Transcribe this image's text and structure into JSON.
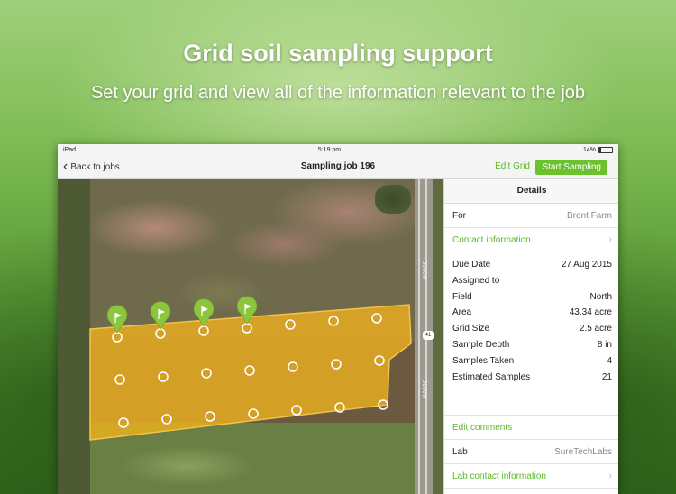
{
  "hero": {
    "title": "Grid soil sampling support",
    "subtitle": "Set your grid and view all of the information relevant to the job"
  },
  "statusbar": {
    "device": "iPad",
    "time": "5:19 pm",
    "battery": "14%"
  },
  "navbar": {
    "back_label": "Back to jobs",
    "title": "Sampling job 196",
    "edit_grid_label": "Edit Grid",
    "start_sampling_label": "Start Sampling"
  },
  "map": {
    "road_label": "S600W",
    "route_number": "41",
    "sampled_count": 4,
    "grid_color": "#f2b21e",
    "flag_color": "#8cc63f"
  },
  "details": {
    "header": "Details",
    "for_label": "For",
    "for_value": "Brent Farm",
    "contact_label": "Contact information",
    "fields": [
      {
        "label": "Due Date",
        "value": "27 Aug 2015"
      },
      {
        "label": "Assigned to",
        "value": ""
      },
      {
        "label": "Field",
        "value": "North"
      },
      {
        "label": "Area",
        "value": "43.34 acre"
      },
      {
        "label": "Grid Size",
        "value": "2.5 acre"
      },
      {
        "label": "Sample Depth",
        "value": "8 in"
      },
      {
        "label": "Samples Taken",
        "value": "4"
      },
      {
        "label": "Estimated Samples",
        "value": "21"
      }
    ],
    "edit_comments_label": "Edit comments",
    "lab_label": "Lab",
    "lab_value": "SureTechLabs",
    "lab_contact_label": "Lab contact information"
  }
}
